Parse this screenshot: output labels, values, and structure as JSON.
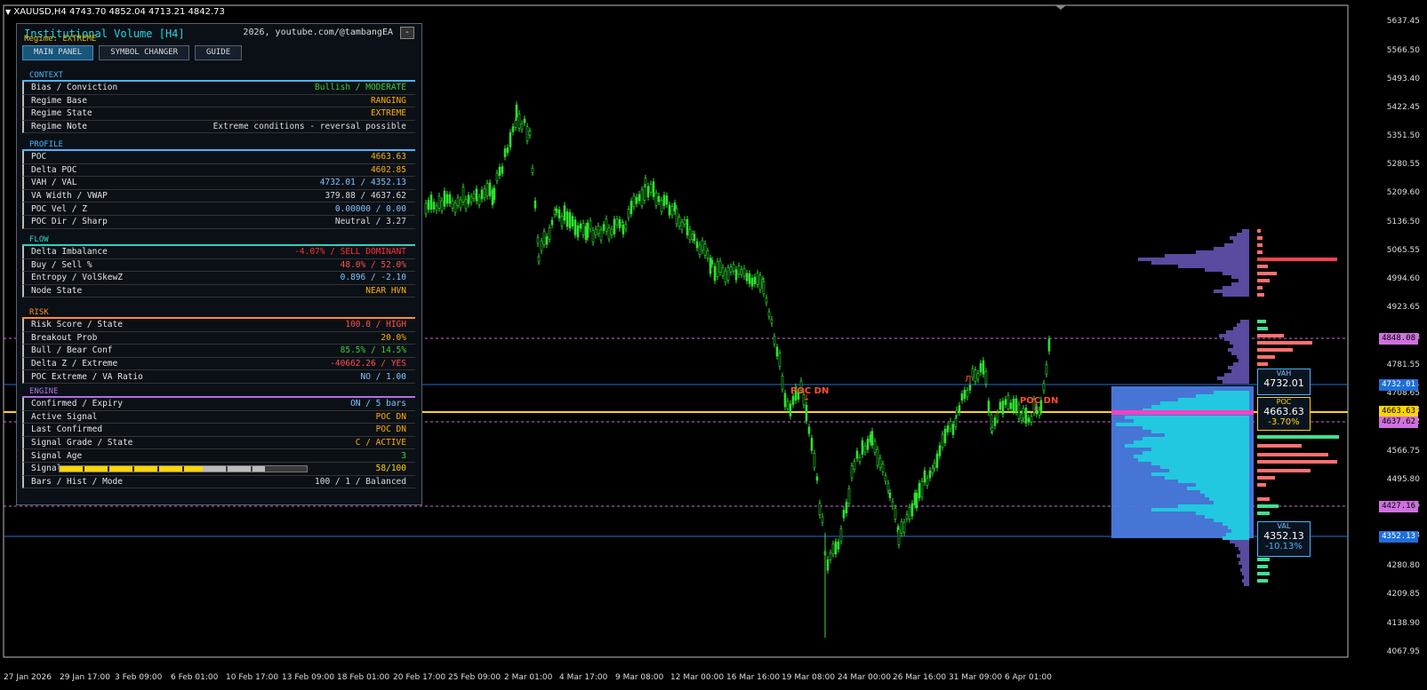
{
  "header": {
    "symbol_line": "XAUUSD,H4  4743.70 4852.04 4713.21 4842.73"
  },
  "panel": {
    "title": "Institutional Volume [H4]",
    "subtitle": "Regime: EXTREME",
    "credit": "2026, youtube.com/@tambangEA",
    "minimize": "-",
    "tabs": [
      "MAIN PANEL",
      "SYMBOL CHANGER",
      "GUIDE"
    ],
    "sections": [
      {
        "name": "CONTEXT",
        "color": "#45b7ff",
        "rows": [
          {
            "label": "Bias / Conviction",
            "value": "Bullish / MODERATE",
            "color": "#3ccf3c"
          },
          {
            "label": "Regime Base",
            "value": "RANGING",
            "color": "#ffb000"
          },
          {
            "label": "Regime State",
            "value": "EXTREME",
            "color": "#ffb000"
          },
          {
            "label": "Regime Note",
            "value": "Extreme conditions - reversal possible",
            "color": "#dddddd"
          }
        ]
      },
      {
        "name": "PROFILE",
        "color": "#45b7ff",
        "rows": [
          {
            "label": "POC",
            "value": "4663.63",
            "color": "#ffb000"
          },
          {
            "label": "Delta POC",
            "value": "4602.85",
            "color": "#ffb000"
          },
          {
            "label": "VAH / VAL",
            "value": "4732.01 / 4352.13",
            "color": "#7fc4ff"
          },
          {
            "label": "VA Width / VWAP",
            "value": "379.88 / 4637.62",
            "color": "#dddddd"
          },
          {
            "label": "POC Vel / Z",
            "value": "0.00000 / 0.00",
            "color": "#7fc4ff"
          },
          {
            "label": "POC Dir / Sharp",
            "value": "Neutral / 3.27",
            "color": "#dddddd"
          }
        ]
      },
      {
        "name": "FLOW",
        "color": "#30d0c0",
        "rows": [
          {
            "label": "Delta Imbalance",
            "value": "-4.07% / SELL DOMINANT",
            "color": "#ff3030"
          },
          {
            "label": "Buy / Sell %",
            "value": "48.0% / 52.0%",
            "color": "#ff5050"
          },
          {
            "label": "Entropy / VolSkewZ",
            "value": "0.896 / -2.10",
            "color": "#7fc4ff"
          },
          {
            "label": "Node State",
            "value": "NEAR HVN",
            "color": "#ffb000"
          }
        ]
      },
      {
        "name": "RISK",
        "color": "#ff9020",
        "rows": [
          {
            "label": "Risk Score / State",
            "value": "100.0 / HIGH",
            "color": "#ff5050"
          },
          {
            "label": "Breakout Prob",
            "value": "20.0%",
            "color": "#ffb000"
          },
          {
            "label": "Bull / Bear Conf",
            "value": "85.5% / 14.5%",
            "color": "#3ccf3c"
          },
          {
            "label": "Delta Z / Extreme",
            "value": "-40662.26 / YES",
            "color": "#ff5050"
          },
          {
            "label": "POC Extreme / VA Ratio",
            "value": "NO / 1.00",
            "color": "#7fc4ff"
          }
        ]
      },
      {
        "name": "ENGINE",
        "color": "#b070e0",
        "rows": [
          {
            "label": "Confirmed / Expiry",
            "value": "ON / 5 bars",
            "color": "#7fc4ff"
          },
          {
            "label": "Active Signal",
            "value": "POC DN",
            "color": "#ffb000"
          },
          {
            "label": "Last Confirmed",
            "value": "POC DN",
            "color": "#ffb000"
          },
          {
            "label": "Signal Grade / State",
            "value": "C / ACTIVE",
            "color": "#ffb000"
          },
          {
            "label": "Signal Age",
            "value": "3",
            "color": "#3ccf3c"
          },
          {
            "label": "Signal",
            "value": "58/100",
            "color": "#ffd500",
            "progress": 0.58
          },
          {
            "label": "Bars / Hist / Mode",
            "value": "100 / 1 / Balanced",
            "color": "#dddddd"
          }
        ]
      }
    ]
  },
  "yaxis": [
    "5637.45",
    "5566.50",
    "5493.40",
    "5422.45",
    "5351.50",
    "5280.55",
    "5209.60",
    "5136.50",
    "5065.55",
    "4994.60",
    "4923.65",
    "4848.08",
    "4781.55",
    "4732.01",
    "4708.65",
    "4663.63",
    "4637.62",
    "4566.75",
    "4495.80",
    "4427.16",
    "4352.13",
    "4280.80",
    "4209.85",
    "4138.90",
    "4067.95"
  ],
  "xaxis": [
    "27 Jan 2026",
    "29 Jan 17:00",
    "3 Feb 09:00",
    "6 Feb 01:00",
    "10 Feb 17:00",
    "13 Feb 09:00",
    "18 Feb 01:00",
    "20 Feb 17:00",
    "25 Feb 09:00",
    "2 Mar 01:00",
    "4 Mar 17:00",
    "9 Mar 08:00",
    "12 Mar 00:00",
    "16 Mar 16:00",
    "19 Mar 08:00",
    "24 Mar 00:00",
    "26 Mar 16:00",
    "31 Mar 09:00",
    "6 Apr 01:00"
  ],
  "levels": {
    "vah": {
      "label": "VAH",
      "value": "4732.01",
      "color": "#1e6fd9"
    },
    "poc": {
      "label": "POC",
      "value": "4663.63",
      "pct": "-3.70%",
      "color": "#ffd500"
    },
    "val": {
      "label": "VAL",
      "value": "4352.13",
      "pct": "-10.13%",
      "color": "#1e6fd9"
    },
    "hvn_upper": {
      "value": "4848.08",
      "color": "#d070e0"
    },
    "vwap": {
      "value": "4637.62",
      "color": "#d070e0"
    },
    "lvn": {
      "value": "4427.16",
      "color": "#d070e0"
    }
  },
  "annotations": {
    "signal1": "POC DN",
    "signal2": "POC DN",
    "marker": "Л"
  }
}
